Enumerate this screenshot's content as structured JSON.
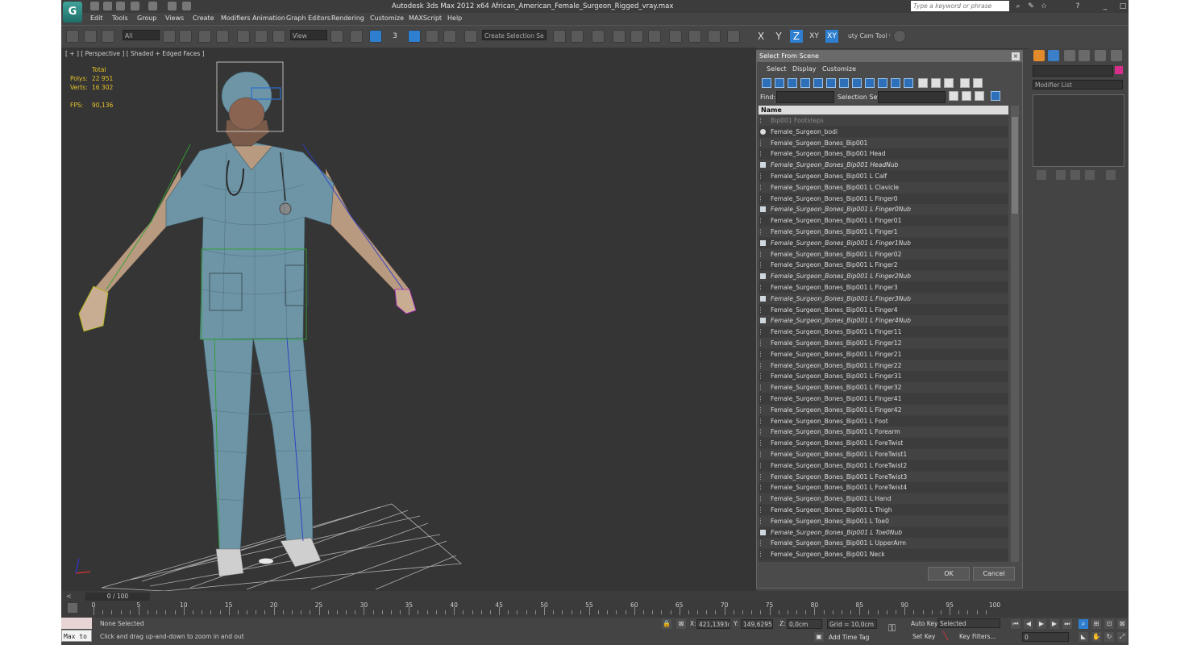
{
  "window": {
    "title": "Autodesk 3ds Max  2012 x64     African_American_Female_Surgeon_Rigged_vray.max",
    "logo": "G",
    "search_placeholder": "Type a keyword or phrase",
    "right_icons": [
      "binoculars-icon",
      "wrench-icon",
      "star-icon",
      "help-icon"
    ]
  },
  "menu": [
    "Edit",
    "Tools",
    "Group",
    "Views",
    "Create",
    "Modifiers",
    "Animation",
    "Graph Editors",
    "Rendering",
    "Customize",
    "MAXScript",
    "Help"
  ],
  "toolbar": {
    "selection_filter": "All",
    "ref_coord": "View",
    "named_selection": "Create Selection Se",
    "snap_label": "3",
    "axes": [
      {
        "label": "X",
        "active": false
      },
      {
        "label": "Y",
        "active": false
      },
      {
        "label": "Z",
        "active": true
      },
      {
        "label": "XY",
        "active": false
      },
      {
        "label": "XY",
        "active": true
      }
    ],
    "cam_tool": "uty Cam Tool v"
  },
  "viewport": {
    "label": "[ + ] [ Perspective ] [ Shaded + Edged Faces ]",
    "stats": {
      "total_label": "Total",
      "polys_label": "Polys:",
      "polys": "22 951",
      "verts_label": "Verts:",
      "verts": "16 302",
      "fps_label": "FPS:",
      "fps": "90,136"
    }
  },
  "dialog": {
    "title": "Select From Scene",
    "menus": [
      "Select",
      "Display",
      "Customize"
    ],
    "find_label": "Find:",
    "selset_label": "Selection Set:",
    "column_header": "Name",
    "ok": "OK",
    "cancel": "Cancel",
    "rows": [
      {
        "label": "Bip001 Footsteps",
        "style": "dim"
      },
      {
        "label": "Female_Surgeon_bodi",
        "style": "mesh"
      },
      {
        "label": "Female_Surgeon_Bones_Bip001",
        "style": "bone"
      },
      {
        "label": "Female_Surgeon_Bones_Bip001 Head",
        "style": "bone"
      },
      {
        "label": "Female_Surgeon_Bones_Bip001 HeadNub",
        "style": "nub"
      },
      {
        "label": "Female_Surgeon_Bones_Bip001 L Calf",
        "style": "bone"
      },
      {
        "label": "Female_Surgeon_Bones_Bip001 L Clavicle",
        "style": "bone"
      },
      {
        "label": "Female_Surgeon_Bones_Bip001 L Finger0",
        "style": "bone"
      },
      {
        "label": "Female_Surgeon_Bones_Bip001 L Finger0Nub",
        "style": "nub"
      },
      {
        "label": "Female_Surgeon_Bones_Bip001 L Finger01",
        "style": "bone"
      },
      {
        "label": "Female_Surgeon_Bones_Bip001 L Finger1",
        "style": "bone"
      },
      {
        "label": "Female_Surgeon_Bones_Bip001 L Finger1Nub",
        "style": "nub"
      },
      {
        "label": "Female_Surgeon_Bones_Bip001 L Finger02",
        "style": "bone"
      },
      {
        "label": "Female_Surgeon_Bones_Bip001 L Finger2",
        "style": "bone"
      },
      {
        "label": "Female_Surgeon_Bones_Bip001 L Finger2Nub",
        "style": "nub"
      },
      {
        "label": "Female_Surgeon_Bones_Bip001 L Finger3",
        "style": "bone"
      },
      {
        "label": "Female_Surgeon_Bones_Bip001 L Finger3Nub",
        "style": "nub"
      },
      {
        "label": "Female_Surgeon_Bones_Bip001 L Finger4",
        "style": "bone"
      },
      {
        "label": "Female_Surgeon_Bones_Bip001 L Finger4Nub",
        "style": "nub"
      },
      {
        "label": "Female_Surgeon_Bones_Bip001 L Finger11",
        "style": "bone"
      },
      {
        "label": "Female_Surgeon_Bones_Bip001 L Finger12",
        "style": "bone"
      },
      {
        "label": "Female_Surgeon_Bones_Bip001 L Finger21",
        "style": "bone"
      },
      {
        "label": "Female_Surgeon_Bones_Bip001 L Finger22",
        "style": "bone"
      },
      {
        "label": "Female_Surgeon_Bones_Bip001 L Finger31",
        "style": "bone"
      },
      {
        "label": "Female_Surgeon_Bones_Bip001 L Finger32",
        "style": "bone"
      },
      {
        "label": "Female_Surgeon_Bones_Bip001 L Finger41",
        "style": "bone"
      },
      {
        "label": "Female_Surgeon_Bones_Bip001 L Finger42",
        "style": "bone"
      },
      {
        "label": "Female_Surgeon_Bones_Bip001 L Foot",
        "style": "bone"
      },
      {
        "label": "Female_Surgeon_Bones_Bip001 L Forearm",
        "style": "bone"
      },
      {
        "label": "Female_Surgeon_Bones_Bip001 L ForeTwist",
        "style": "bone"
      },
      {
        "label": "Female_Surgeon_Bones_Bip001 L ForeTwist1",
        "style": "bone"
      },
      {
        "label": "Female_Surgeon_Bones_Bip001 L ForeTwist2",
        "style": "bone"
      },
      {
        "label": "Female_Surgeon_Bones_Bip001 L ForeTwist3",
        "style": "bone"
      },
      {
        "label": "Female_Surgeon_Bones_Bip001 L ForeTwist4",
        "style": "bone"
      },
      {
        "label": "Female_Surgeon_Bones_Bip001 L Hand",
        "style": "bone"
      },
      {
        "label": "Female_Surgeon_Bones_Bip001 L Thigh",
        "style": "bone"
      },
      {
        "label": "Female_Surgeon_Bones_Bip001 L Toe0",
        "style": "bone"
      },
      {
        "label": "Female_Surgeon_Bones_Bip001 L Toe0Nub",
        "style": "nub"
      },
      {
        "label": "Female_Surgeon_Bones_Bip001 L UpperArm",
        "style": "bone"
      },
      {
        "label": "Female_Surgeon_Bones_Bip001 Neck",
        "style": "bone"
      }
    ]
  },
  "command_panel": {
    "modifier_list": "Modifier List",
    "object_color": "#d92d8a"
  },
  "timeline": {
    "frame": "0 / 100",
    "ticks": [
      0,
      5,
      10,
      15,
      20,
      25,
      30,
      35,
      40,
      45,
      50,
      55,
      60,
      65,
      70,
      75,
      80,
      85,
      90,
      95,
      100
    ]
  },
  "status": {
    "maxscript": "Max to",
    "selection": "None Selected",
    "prompt": "Click and drag up-and-down to zoom in and out",
    "x_label": "X:",
    "x": "421,1393c",
    "y_label": "Y:",
    "y": "149,6295c",
    "z_label": "Z:",
    "z": "0,0cm",
    "grid": "Grid = 10,0cm",
    "add_time_tag": "Add Time Tag",
    "auto_key": "Auto Key",
    "set_key": "Set Key",
    "key_mode": "Selected",
    "key_filters": "Key Filters...",
    "frame_field": "0"
  }
}
